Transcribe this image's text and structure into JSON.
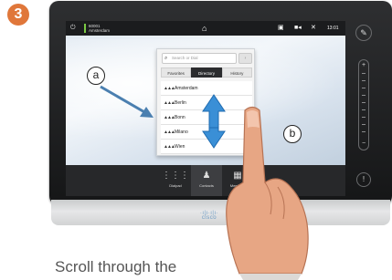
{
  "step": "3",
  "topbar": {
    "system_id": "60001",
    "system_name": "Amsterdam",
    "time": "13:01"
  },
  "directory": {
    "search_placeholder": "Search or Dial",
    "tabs": [
      {
        "label": "Favorites",
        "active": false
      },
      {
        "label": "Directory",
        "active": true
      },
      {
        "label": "History",
        "active": false
      }
    ],
    "entries": [
      "Amsterdam",
      "Berlin",
      "Bonn",
      "Milano",
      "Wien"
    ]
  },
  "callouts": {
    "a": "a",
    "b": "b"
  },
  "bottombar": {
    "items": [
      {
        "label": "Dialpad",
        "icon": "dialpad-icon"
      },
      {
        "label": "Contacts",
        "icon": "contacts-icon",
        "active": true
      },
      {
        "label": "Meetings",
        "icon": "meetings-icon"
      }
    ]
  },
  "brand": "cisco",
  "caption": "Scroll through the",
  "colors": {
    "badge": "#e0773a",
    "scroll_arrow": "#3a8fd6",
    "status_green": "#7ac943"
  }
}
